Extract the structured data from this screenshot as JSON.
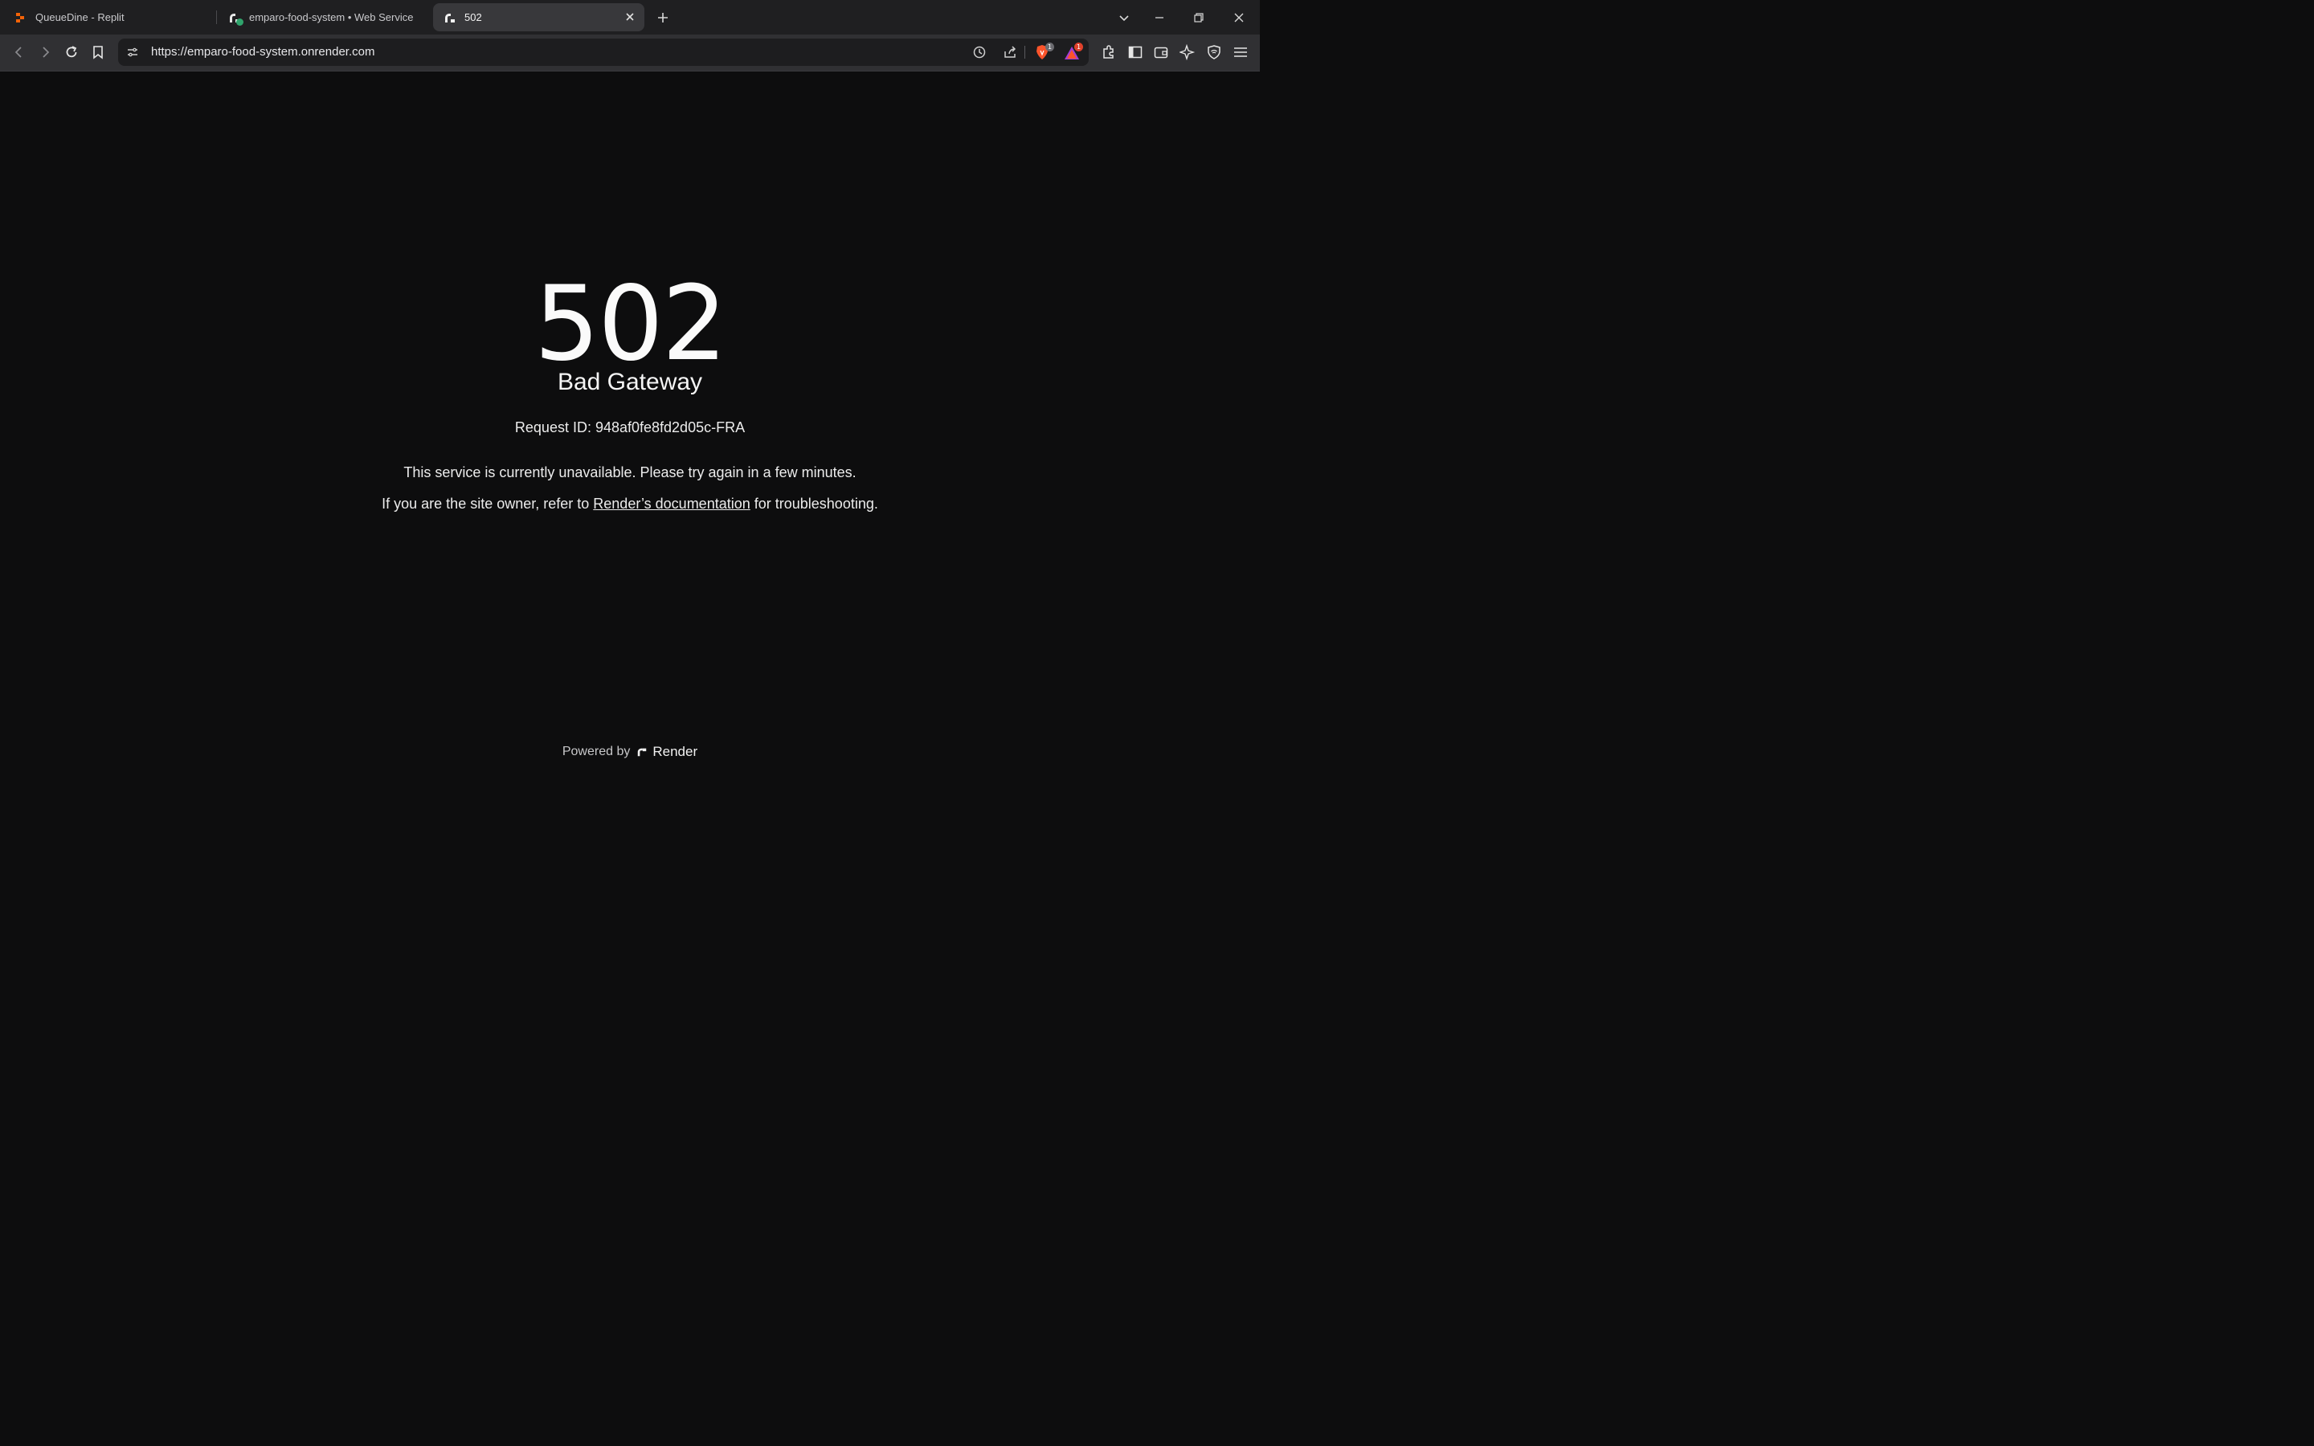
{
  "browser": {
    "tabs": [
      {
        "title": "QueueDine - Replit",
        "icon": "replit-icon"
      },
      {
        "title": "emparo-food-system • Web Service",
        "icon": "render-icon"
      },
      {
        "title": "502",
        "icon": "render-icon"
      }
    ],
    "address_bar": {
      "url": "https://emparo-food-system.onrender.com"
    },
    "badges": {
      "brave_shields": "1",
      "rewards": "1"
    }
  },
  "error_page": {
    "status_code": "502",
    "status_text": "Bad Gateway",
    "request_id": "Request ID: 948af0fe8fd2d05c-FRA",
    "message": "This service is currently unavailable. Please try again in a few minutes.",
    "owner_prefix": "If you are the site owner, refer to ",
    "docs_link": "Render’s documentation",
    "owner_suffix": " for troubleshooting.",
    "footer_prefix": "Powered by",
    "footer_brand": "Render"
  },
  "colors": {
    "background": "#0d0d0e",
    "text": "#ececec",
    "tabstrip": "#1f1f21",
    "toolbar": "#303033",
    "active_tab": "#38383b"
  }
}
